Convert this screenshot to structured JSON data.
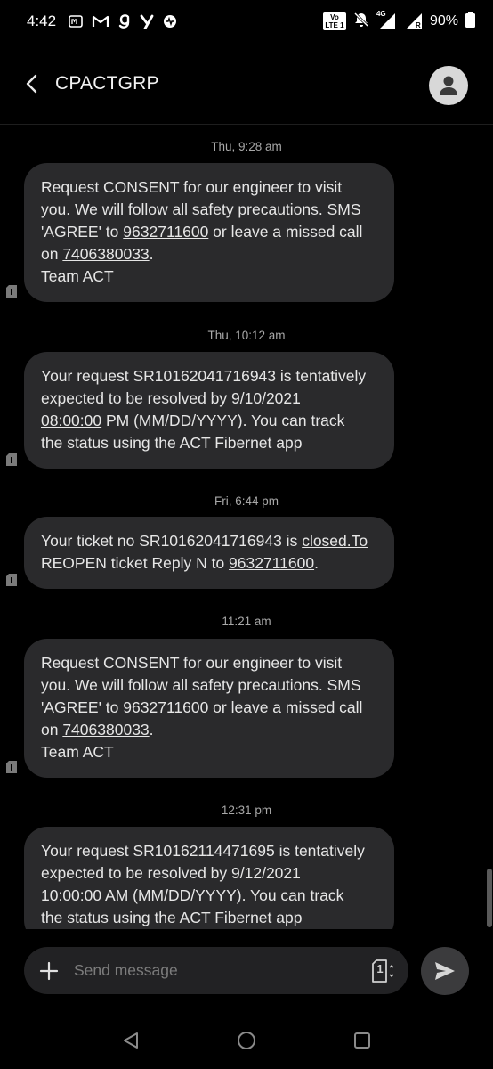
{
  "status_bar": {
    "time": "4:42",
    "network": "4G",
    "roaming": "R",
    "volte_top": "Vo",
    "volte_bottom": "LTE 1",
    "battery": "90%"
  },
  "header": {
    "contact": "CPACTGRP"
  },
  "messages": [
    {
      "timestamp": "Thu, 9:28 am",
      "lines": [
        [
          {
            "t": "Request CONSENT for our engineer to visit"
          }
        ],
        [
          {
            "t": "you. We will follow all safety precautions. SMS"
          }
        ],
        [
          {
            "t": "'AGREE' to "
          },
          {
            "t": "9632711600",
            "link": true
          },
          {
            "t": " or leave a missed call"
          }
        ],
        [
          {
            "t": "on "
          },
          {
            "t": "7406380033",
            "link": true
          },
          {
            "t": "."
          }
        ],
        [
          {
            "t": "Team ACT"
          }
        ]
      ]
    },
    {
      "timestamp": "Thu, 10:12 am",
      "lines": [
        [
          {
            "t": "Your request SR10162041716943 is tentatively"
          }
        ],
        [
          {
            "t": "expected to be resolved by 9/10/2021"
          }
        ],
        [
          {
            "t": "08:00:00",
            "link": true
          },
          {
            "t": " PM (MM/DD/YYYY). You can track"
          }
        ],
        [
          {
            "t": "the status using the ACT Fibernet app"
          }
        ]
      ]
    },
    {
      "timestamp": "Fri, 6:44 pm",
      "lines": [
        [
          {
            "t": "Your ticket no SR10162041716943 is "
          },
          {
            "t": "closed.To",
            "link": true
          }
        ],
        [
          {
            "t": "REOPEN ticket Reply N to "
          },
          {
            "t": "9632711600",
            "link": true
          },
          {
            "t": "."
          }
        ]
      ]
    },
    {
      "timestamp": "11:21 am",
      "lines": [
        [
          {
            "t": "Request CONSENT for our engineer to visit"
          }
        ],
        [
          {
            "t": "you. We will follow all safety precautions. SMS"
          }
        ],
        [
          {
            "t": "'AGREE' to "
          },
          {
            "t": "9632711600",
            "link": true
          },
          {
            "t": " or leave a missed call"
          }
        ],
        [
          {
            "t": "on "
          },
          {
            "t": "7406380033",
            "link": true
          },
          {
            "t": "."
          }
        ],
        [
          {
            "t": "Team ACT"
          }
        ]
      ]
    },
    {
      "timestamp": "12:31 pm",
      "lines": [
        [
          {
            "t": "Your request SR10162114471695 is tentatively"
          }
        ],
        [
          {
            "t": "expected to be resolved by 9/12/2021"
          }
        ],
        [
          {
            "t": "10:00:00",
            "link": true
          },
          {
            "t": " AM (MM/DD/YYYY). You can track"
          }
        ],
        [
          {
            "t": "the status using the ACT Fibernet app"
          }
        ]
      ]
    }
  ],
  "compose": {
    "placeholder": "Send message",
    "sim_slot": "1"
  },
  "colors": {
    "background": "#000000",
    "bubble": "#2a2a2c",
    "compose": "#222224",
    "send": "#3b3b3d"
  },
  "icons": {
    "back": "arrow-left-icon",
    "avatar": "person-icon",
    "add": "plus-icon",
    "sim": "sim-card-icon",
    "send": "send-icon"
  }
}
